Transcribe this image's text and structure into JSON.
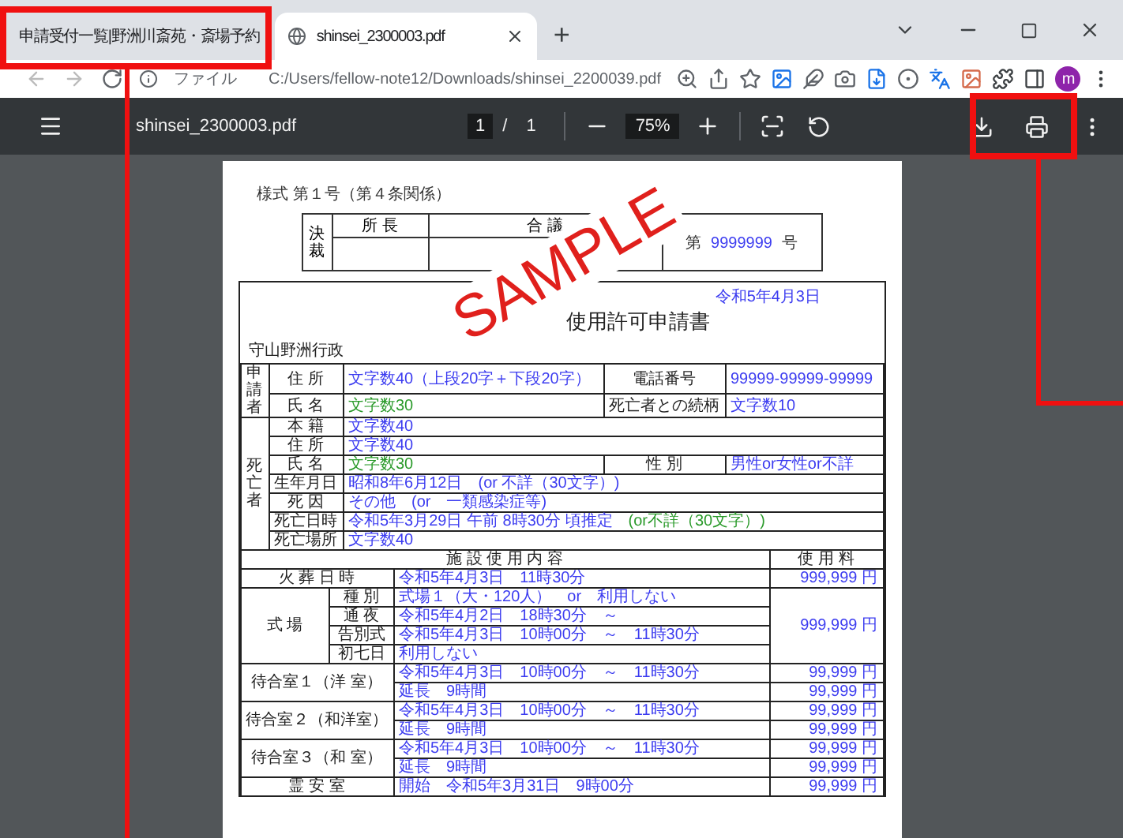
{
  "browser": {
    "tabs": [
      {
        "title": "申請受付一覧|野洲川斎苑・斎場予約",
        "selected": false
      },
      {
        "title": "shinsei_2300003.pdf",
        "selected": true
      }
    ],
    "new_tab": "+",
    "address": {
      "scheme_label": "ファイル",
      "url": "C:/Users/fellow-note12/Downloads/shinsei_2200039.pdf"
    },
    "profile": "m"
  },
  "pdf_toolbar": {
    "file_name": "shinsei_2300003.pdf",
    "page": "1",
    "page_separator": "/",
    "page_total": "1",
    "zoom": "75%"
  },
  "document": {
    "form_number": "様式 第１号（第４条関係）",
    "approval": {
      "label": "決裁",
      "columns": [
        "所 長",
        "合 議"
      ],
      "number_prefix": "第",
      "number": "9999999",
      "number_suffix": "号"
    },
    "date": "令和5年4月3日",
    "title": "使用許可申請書",
    "addressee": "守山野洲行政",
    "upper_rows": [
      [
        {
          "kind": "section",
          "text": "申請者",
          "rowspan": 2
        },
        {
          "kind": "label",
          "text": "住 所"
        },
        {
          "kind": "value",
          "text": "文字数40（上段20字＋下段20字）",
          "color": "#3c3cf0"
        },
        {
          "kind": "label",
          "text": "電話番号"
        },
        {
          "kind": "value",
          "text": "99999-99999-99999",
          "color": "#3c3cf0"
        }
      ],
      [
        {
          "kind": "label",
          "text": "氏 名"
        },
        {
          "kind": "value",
          "text": "文字数30",
          "color": "#2a9a2a"
        },
        {
          "kind": "label",
          "text": "死亡者との続柄"
        },
        {
          "kind": "value",
          "text": "文字数10",
          "color": "#3c3cf0"
        }
      ],
      [
        {
          "kind": "section",
          "text": "死亡者",
          "rowspan": 7
        },
        {
          "kind": "label",
          "text": "本 籍"
        },
        {
          "kind": "value",
          "text": "文字数40",
          "color": "#3c3cf0",
          "colspan": 3
        }
      ],
      [
        {
          "kind": "label",
          "text": "住 所"
        },
        {
          "kind": "value",
          "text": "文字数40",
          "color": "#3c3cf0",
          "colspan": 3
        }
      ],
      [
        {
          "kind": "label",
          "text": "氏 名"
        },
        {
          "kind": "value",
          "text": "文字数30",
          "color": "#2a9a2a"
        },
        {
          "kind": "label",
          "text": "性 別"
        },
        {
          "kind": "value",
          "text": "男性or女性or不詳",
          "color": "#3c3cf0"
        }
      ],
      [
        {
          "kind": "label",
          "text": "生年月日"
        },
        {
          "kind": "value",
          "text": "昭和8年6月12日　(or 不詳（30文字）)",
          "color": "#3c3cf0",
          "colspan": 3
        }
      ],
      [
        {
          "kind": "label",
          "text": "死 因"
        },
        {
          "kind": "value",
          "text": "その他　(or　一類感染症等)",
          "color": "#3c3cf0",
          "colspan": 3
        }
      ],
      [
        {
          "kind": "label",
          "text": "死亡日時"
        },
        {
          "kind": "value",
          "colspan": 3,
          "parts": [
            {
              "text": "令和5年3月29日 午前 8時30分 頃推定",
              "color": "#3c3cf0"
            },
            {
              "text": "(or不詳（30文字）)",
              "color": "#2a9a2a"
            }
          ]
        }
      ],
      [
        {
          "kind": "label",
          "text": "死亡場所"
        },
        {
          "kind": "value",
          "text": "文字数40",
          "color": "#3c3cf0",
          "colspan": 3
        }
      ]
    ],
    "lower_rows": [
      [
        {
          "kind": "heading",
          "text": "施 設 使 用 内 容",
          "colspan": 3
        },
        {
          "kind": "heading",
          "text": "使 用 料"
        }
      ],
      [
        {
          "kind": "label",
          "text": "火 葬 日 時",
          "colspan": 2
        },
        {
          "kind": "value",
          "text": "令和5年4月3日　11時30分",
          "color": "#3c3cf0"
        },
        {
          "kind": "fee",
          "text": "999,999 円",
          "color": "#3c3cf0"
        }
      ],
      [
        {
          "kind": "label",
          "text": "式 場",
          "rowspan": 4
        },
        {
          "kind": "label",
          "text": "種 別"
        },
        {
          "kind": "value",
          "text": "式場１（大・120人）　or　利用しない",
          "color": "#3c3cf0"
        },
        {
          "kind": "fee",
          "text": "999,999 円",
          "color": "#3c3cf0",
          "rowspan": 4
        }
      ],
      [
        {
          "kind": "label",
          "text": "通 夜"
        },
        {
          "kind": "value",
          "text": "令和5年4月2日　18時30分　～",
          "color": "#3c3cf0"
        }
      ],
      [
        {
          "kind": "label",
          "text": "告別式"
        },
        {
          "kind": "value",
          "text": "令和5年4月3日　10時00分　～　11時30分",
          "color": "#3c3cf0"
        }
      ],
      [
        {
          "kind": "label",
          "text": "初七日"
        },
        {
          "kind": "value",
          "text": "利用しない",
          "color": "#3c3cf0"
        }
      ],
      [
        {
          "kind": "label",
          "text": "待合室１（洋 室）",
          "colspan": 2,
          "rowspan": 2
        },
        {
          "kind": "value",
          "text": "令和5年4月3日　10時00分　～　11時30分",
          "color": "#3c3cf0"
        },
        {
          "kind": "fee",
          "text": "99,999 円",
          "color": "#3c3cf0"
        }
      ],
      [
        {
          "kind": "value",
          "text": "延長　9時間",
          "color": "#3c3cf0"
        },
        {
          "kind": "fee",
          "text": "99,999 円",
          "color": "#3c3cf0"
        }
      ],
      [
        {
          "kind": "label",
          "text": "待合室２（和洋室）",
          "colspan": 2,
          "rowspan": 2
        },
        {
          "kind": "value",
          "text": "令和5年4月3日　10時00分　～　11時30分",
          "color": "#3c3cf0"
        },
        {
          "kind": "fee",
          "text": "99,999 円",
          "color": "#3c3cf0"
        }
      ],
      [
        {
          "kind": "value",
          "text": "延長　9時間",
          "color": "#3c3cf0"
        },
        {
          "kind": "fee",
          "text": "99,999 円",
          "color": "#3c3cf0"
        }
      ],
      [
        {
          "kind": "label",
          "text": "待合室３（和 室）",
          "colspan": 2,
          "rowspan": 2
        },
        {
          "kind": "value",
          "text": "令和5年4月3日　10時00分　～　11時30分",
          "color": "#3c3cf0"
        },
        {
          "kind": "fee",
          "text": "99,999 円",
          "color": "#3c3cf0"
        }
      ],
      [
        {
          "kind": "value",
          "text": "延長　9時間",
          "color": "#3c3cf0"
        },
        {
          "kind": "fee",
          "text": "99,999 円",
          "color": "#3c3cf0"
        }
      ],
      [
        {
          "kind": "label",
          "text": "霊 安 室",
          "colspan": 2
        },
        {
          "kind": "value",
          "text": "開始　令和5年3月31日　9時00分",
          "color": "#3c3cf0"
        },
        {
          "kind": "fee",
          "text": "99,999 円",
          "color": "#3c3cf0"
        }
      ]
    ]
  },
  "stamp": "SAMPLE"
}
